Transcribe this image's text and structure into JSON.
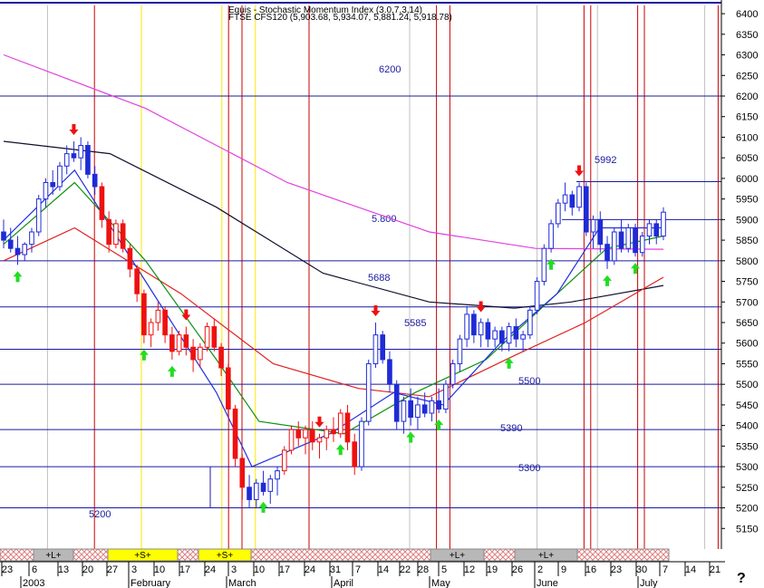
{
  "header": {
    "line1": "Equis - Stochastic Momentum Index (3.0,7,3,14)",
    "line2": "FTSE CFS120 (5,903.68, 5,934.07, 5,881.24, 5,918.78)"
  },
  "help_glyph": "?",
  "colors": {
    "level_line": "#1a1aa0",
    "red_vline": "#cc0000",
    "yellow_vline": "#ffe600",
    "grey_vline": "#c0c0c0",
    "up_candle": "#ffffff",
    "down_candle": "#1f2bd6",
    "red_candle": "#ee1111",
    "ma_magenta": "#e040e0",
    "ma_black": "#101030",
    "ma_red": "#e02020",
    "ma_green": "#109010",
    "ma_blue": "#2030e0",
    "arrow_up": "#22dd22",
    "arrow_down": "#ee1111",
    "band_hatch": "#e08080",
    "band_yellow": "#ffff00",
    "band_grey": "#b8b8b8"
  },
  "chart_data": {
    "type": "candlestick",
    "y_axis": {
      "range": [
        5100,
        6420
      ],
      "ticks": [
        5150,
        5200,
        5250,
        5300,
        5350,
        5400,
        5450,
        5500,
        5550,
        5600,
        5650,
        5700,
        5750,
        5800,
        5850,
        5900,
        5950,
        6000,
        6050,
        6100,
        6150,
        6200,
        6250,
        6300,
        6350,
        6400
      ]
    },
    "x_axis": {
      "day_ticks": [
        "23",
        "6",
        "13",
        "20",
        "27",
        "3",
        "10",
        "17",
        "24",
        "3",
        "10",
        "17",
        "24",
        "31",
        "7",
        "14",
        "22",
        "28",
        "5",
        "12",
        "19",
        "26",
        "2",
        "9",
        "16",
        "23",
        "30",
        "7",
        "14",
        "21"
      ],
      "month_labels": [
        "2003",
        "February",
        "March",
        "April",
        "May",
        "June",
        "July"
      ]
    },
    "levels": [
      {
        "value": 6200,
        "label": "6200"
      },
      {
        "value": 5992,
        "label": "5992"
      },
      {
        "value": 5900,
        "label": ""
      },
      {
        "value": 5800,
        "label": "5.800"
      },
      {
        "value": 5688,
        "label": "5688"
      },
      {
        "value": 5585,
        "label": "5585"
      },
      {
        "value": 5500,
        "label": "5500"
      },
      {
        "value": 5390,
        "label": "5390"
      },
      {
        "value": 5300,
        "label": "5300"
      },
      {
        "value": 5200,
        "label": "5200"
      }
    ],
    "signal_bands": [
      {
        "label": "+L+",
        "style": "grey"
      },
      {
        "label": "+S+",
        "style": "yellow"
      },
      {
        "label": "+S+",
        "style": "yellow"
      },
      {
        "label": "+L+",
        "style": "grey"
      },
      {
        "label": "+L+",
        "style": "grey"
      }
    ],
    "series": [
      {
        "name": "",
        "style": "candles",
        "ohlc": [
          [
            5870,
            5900,
            5830,
            5850
          ],
          [
            5850,
            5880,
            5820,
            5830
          ],
          [
            5830,
            5860,
            5790,
            5815
          ],
          [
            5815,
            5845,
            5800,
            5840
          ],
          [
            5840,
            5880,
            5820,
            5870
          ],
          [
            5870,
            5960,
            5860,
            5950
          ],
          [
            5950,
            6000,
            5930,
            5990
          ],
          [
            5990,
            6020,
            5960,
            5980
          ],
          [
            5980,
            6040,
            5970,
            6030
          ],
          [
            6030,
            6080,
            6010,
            6060
          ],
          [
            6060,
            6090,
            6040,
            6050
          ],
          [
            6050,
            6100,
            6020,
            6080
          ],
          [
            6080,
            6090,
            6000,
            6010
          ],
          [
            6010,
            6030,
            5960,
            5980
          ],
          [
            5980,
            5990,
            5880,
            5900
          ],
          [
            5900,
            5920,
            5820,
            5840
          ],
          [
            5840,
            5900,
            5830,
            5890
          ],
          [
            5890,
            5900,
            5820,
            5830
          ],
          [
            5830,
            5840,
            5760,
            5780
          ],
          [
            5780,
            5790,
            5700,
            5720
          ],
          [
            5720,
            5730,
            5600,
            5620
          ],
          [
            5620,
            5660,
            5590,
            5650
          ],
          [
            5650,
            5700,
            5630,
            5680
          ],
          [
            5680,
            5690,
            5600,
            5620
          ],
          [
            5620,
            5640,
            5560,
            5580
          ],
          [
            5580,
            5630,
            5570,
            5620
          ],
          [
            5620,
            5640,
            5570,
            5590
          ],
          [
            5590,
            5610,
            5530,
            5560
          ],
          [
            5560,
            5600,
            5540,
            5590
          ],
          [
            5590,
            5650,
            5580,
            5640
          ],
          [
            5640,
            5660,
            5580,
            5590
          ],
          [
            5590,
            5600,
            5520,
            5540
          ],
          [
            5540,
            5550,
            5420,
            5440
          ],
          [
            5440,
            5450,
            5300,
            5320
          ],
          [
            5320,
            5330,
            5220,
            5250
          ],
          [
            5250,
            5280,
            5200,
            5220
          ],
          [
            5220,
            5270,
            5200,
            5260
          ],
          [
            5260,
            5290,
            5230,
            5240
          ],
          [
            5240,
            5280,
            5210,
            5270
          ],
          [
            5270,
            5300,
            5230,
            5290
          ],
          [
            5290,
            5350,
            5280,
            5340
          ],
          [
            5340,
            5400,
            5330,
            5390
          ],
          [
            5390,
            5410,
            5350,
            5370
          ],
          [
            5370,
            5400,
            5330,
            5390
          ],
          [
            5390,
            5410,
            5340,
            5360
          ],
          [
            5360,
            5380,
            5320,
            5370
          ],
          [
            5370,
            5400,
            5340,
            5390
          ],
          [
            5390,
            5420,
            5360,
            5380
          ],
          [
            5380,
            5440,
            5370,
            5430
          ],
          [
            5430,
            5450,
            5340,
            5360
          ],
          [
            5360,
            5380,
            5280,
            5300
          ],
          [
            5300,
            5420,
            5290,
            5410
          ],
          [
            5410,
            5560,
            5400,
            5550
          ],
          [
            5550,
            5650,
            5540,
            5620
          ],
          [
            5620,
            5630,
            5550,
            5560
          ],
          [
            5560,
            5580,
            5480,
            5500
          ],
          [
            5500,
            5510,
            5390,
            5410
          ],
          [
            5410,
            5470,
            5380,
            5460
          ],
          [
            5460,
            5490,
            5400,
            5420
          ],
          [
            5420,
            5470,
            5390,
            5450
          ],
          [
            5450,
            5480,
            5420,
            5430
          ],
          [
            5430,
            5470,
            5410,
            5460
          ],
          [
            5460,
            5490,
            5430,
            5440
          ],
          [
            5440,
            5510,
            5430,
            5500
          ],
          [
            5500,
            5560,
            5490,
            5550
          ],
          [
            5550,
            5620,
            5530,
            5610
          ],
          [
            5610,
            5690,
            5590,
            5670
          ],
          [
            5670,
            5680,
            5600,
            5620
          ],
          [
            5620,
            5660,
            5590,
            5650
          ],
          [
            5650,
            5660,
            5590,
            5610
          ],
          [
            5610,
            5640,
            5590,
            5630
          ],
          [
            5630,
            5640,
            5580,
            5600
          ],
          [
            5600,
            5650,
            5580,
            5640
          ],
          [
            5640,
            5660,
            5590,
            5610
          ],
          [
            5610,
            5630,
            5580,
            5620
          ],
          [
            5620,
            5690,
            5610,
            5680
          ],
          [
            5680,
            5760,
            5670,
            5750
          ],
          [
            5750,
            5840,
            5740,
            5830
          ],
          [
            5830,
            5900,
            5820,
            5890
          ],
          [
            5890,
            5950,
            5880,
            5940
          ],
          [
            5940,
            5990,
            5920,
            5960
          ],
          [
            5960,
            5970,
            5910,
            5930
          ],
          [
            5930,
            5990,
            5920,
            5980
          ],
          [
            5980,
            5990,
            5860,
            5870
          ],
          [
            5870,
            5910,
            5830,
            5900
          ],
          [
            5900,
            5920,
            5820,
            5840
          ],
          [
            5840,
            5860,
            5780,
            5800
          ],
          [
            5800,
            5880,
            5790,
            5870
          ],
          [
            5870,
            5900,
            5820,
            5830
          ],
          [
            5830,
            5890,
            5820,
            5880
          ],
          [
            5880,
            5890,
            5810,
            5820
          ],
          [
            5820,
            5870,
            5810,
            5860
          ],
          [
            5860,
            5900,
            5840,
            5890
          ],
          [
            5890,
            5900,
            5840,
            5860
          ],
          [
            5860,
            5930,
            5850,
            5918
          ]
        ]
      },
      {
        "name": "",
        "style": "line",
        "color_key": "ma_magenta",
        "points": [
          [
            0,
            6300
          ],
          [
            20,
            6170
          ],
          [
            40,
            5990
          ],
          [
            60,
            5870
          ],
          [
            75,
            5830
          ],
          [
            93,
            5828
          ]
        ]
      },
      {
        "name": "",
        "style": "line",
        "color_key": "ma_black",
        "points": [
          [
            0,
            6090
          ],
          [
            15,
            6060
          ],
          [
            30,
            5930
          ],
          [
            45,
            5770
          ],
          [
            60,
            5700
          ],
          [
            72,
            5685
          ],
          [
            80,
            5700
          ],
          [
            93,
            5740
          ]
        ]
      },
      {
        "name": "",
        "style": "line",
        "color_key": "ma_red",
        "points": [
          [
            0,
            5800
          ],
          [
            10,
            5880
          ],
          [
            25,
            5720
          ],
          [
            38,
            5550
          ],
          [
            50,
            5490
          ],
          [
            60,
            5470
          ],
          [
            72,
            5570
          ],
          [
            82,
            5650
          ],
          [
            93,
            5760
          ]
        ]
      },
      {
        "name": "",
        "style": "line",
        "color_key": "ma_green",
        "points": [
          [
            0,
            5840
          ],
          [
            10,
            5990
          ],
          [
            20,
            5800
          ],
          [
            30,
            5560
          ],
          [
            36,
            5410
          ],
          [
            48,
            5380
          ],
          [
            58,
            5480
          ],
          [
            68,
            5560
          ],
          [
            78,
            5720
          ],
          [
            85,
            5830
          ],
          [
            93,
            5860
          ]
        ]
      },
      {
        "name": "",
        "style": "line",
        "color_key": "ma_blue",
        "points": [
          [
            0,
            5850
          ],
          [
            10,
            6020
          ],
          [
            20,
            5750
          ],
          [
            30,
            5480
          ],
          [
            35,
            5300
          ],
          [
            46,
            5380
          ],
          [
            55,
            5480
          ],
          [
            62,
            5450
          ],
          [
            70,
            5600
          ],
          [
            78,
            5720
          ],
          [
            84,
            5880
          ],
          [
            93,
            5880
          ]
        ]
      }
    ],
    "arrows_up_at": [
      2,
      20,
      24,
      37,
      48,
      58,
      62,
      72,
      78,
      86,
      90
    ],
    "arrows_down_at": [
      10,
      26,
      45,
      53,
      68,
      82
    ]
  }
}
